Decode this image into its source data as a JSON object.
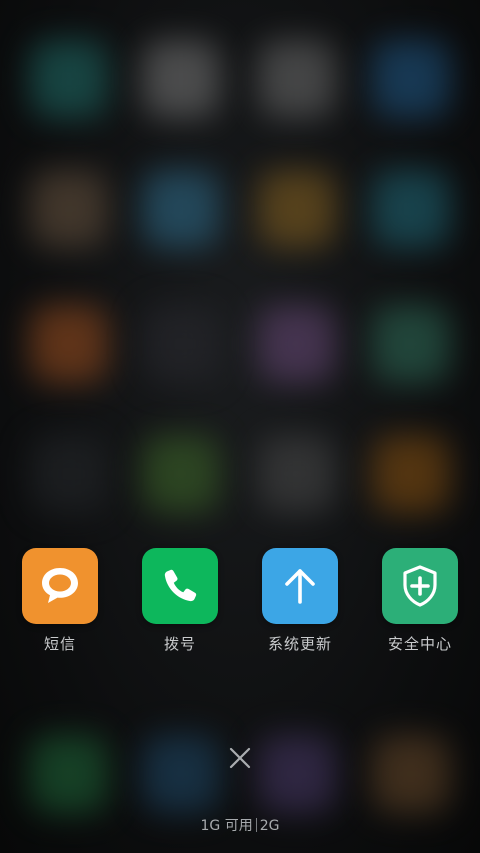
{
  "colors": {
    "sms_icon_bg": "#F0922E",
    "dialer_icon_bg": "#0DB75C",
    "update_icon_bg": "#3CA6E6",
    "security_icon_bg": "#2CAF78",
    "label_text": "#C9CBCD"
  },
  "recent_apps": [
    {
      "label": "短信",
      "icon": "chat-bubble-icon"
    },
    {
      "label": "拨号",
      "icon": "phone-icon"
    },
    {
      "label": "系统更新",
      "icon": "up-arrow-icon"
    },
    {
      "label": "安全中心",
      "icon": "shield-plus-icon"
    }
  ],
  "close_icon": "close-icon",
  "memory": {
    "available": "1G 可用",
    "total": "2G"
  }
}
